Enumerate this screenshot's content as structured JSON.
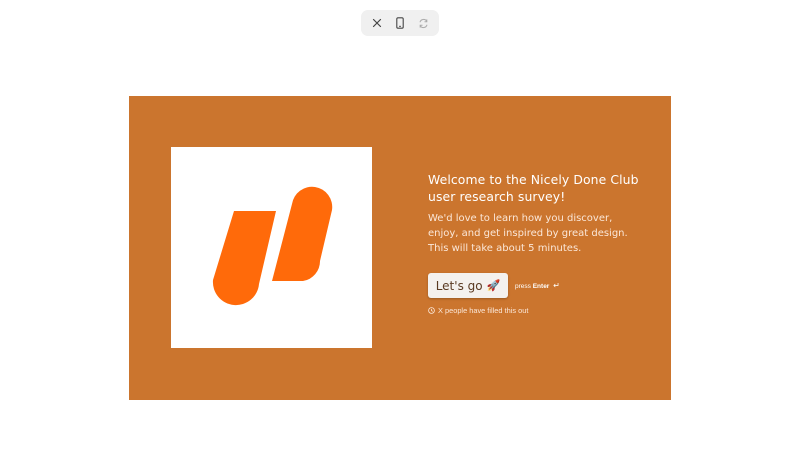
{
  "toolbar": {
    "close_icon": "close-icon",
    "mobile_icon": "mobile-icon",
    "refresh_icon": "refresh-icon"
  },
  "colors": {
    "background": "#cb752e",
    "logo_accent": "#ff6a0a",
    "button_bg": "#f4f1ee"
  },
  "welcome": {
    "title_line1": "Welcome to the Nicely Done Club",
    "title_line2": "user research survey!",
    "desc_line1": "We'd love to learn how you discover,",
    "desc_line2": "enjoy, and get inspired by great design.",
    "desc_line3": "This will take about 5 minutes."
  },
  "cta": {
    "label": "Let's go",
    "emoji": "🚀",
    "hint_press": "press",
    "hint_key": "Enter",
    "hint_icon": "↵"
  },
  "footer": {
    "filled_text": "X people have filled this out",
    "icon": "clock-icon"
  }
}
